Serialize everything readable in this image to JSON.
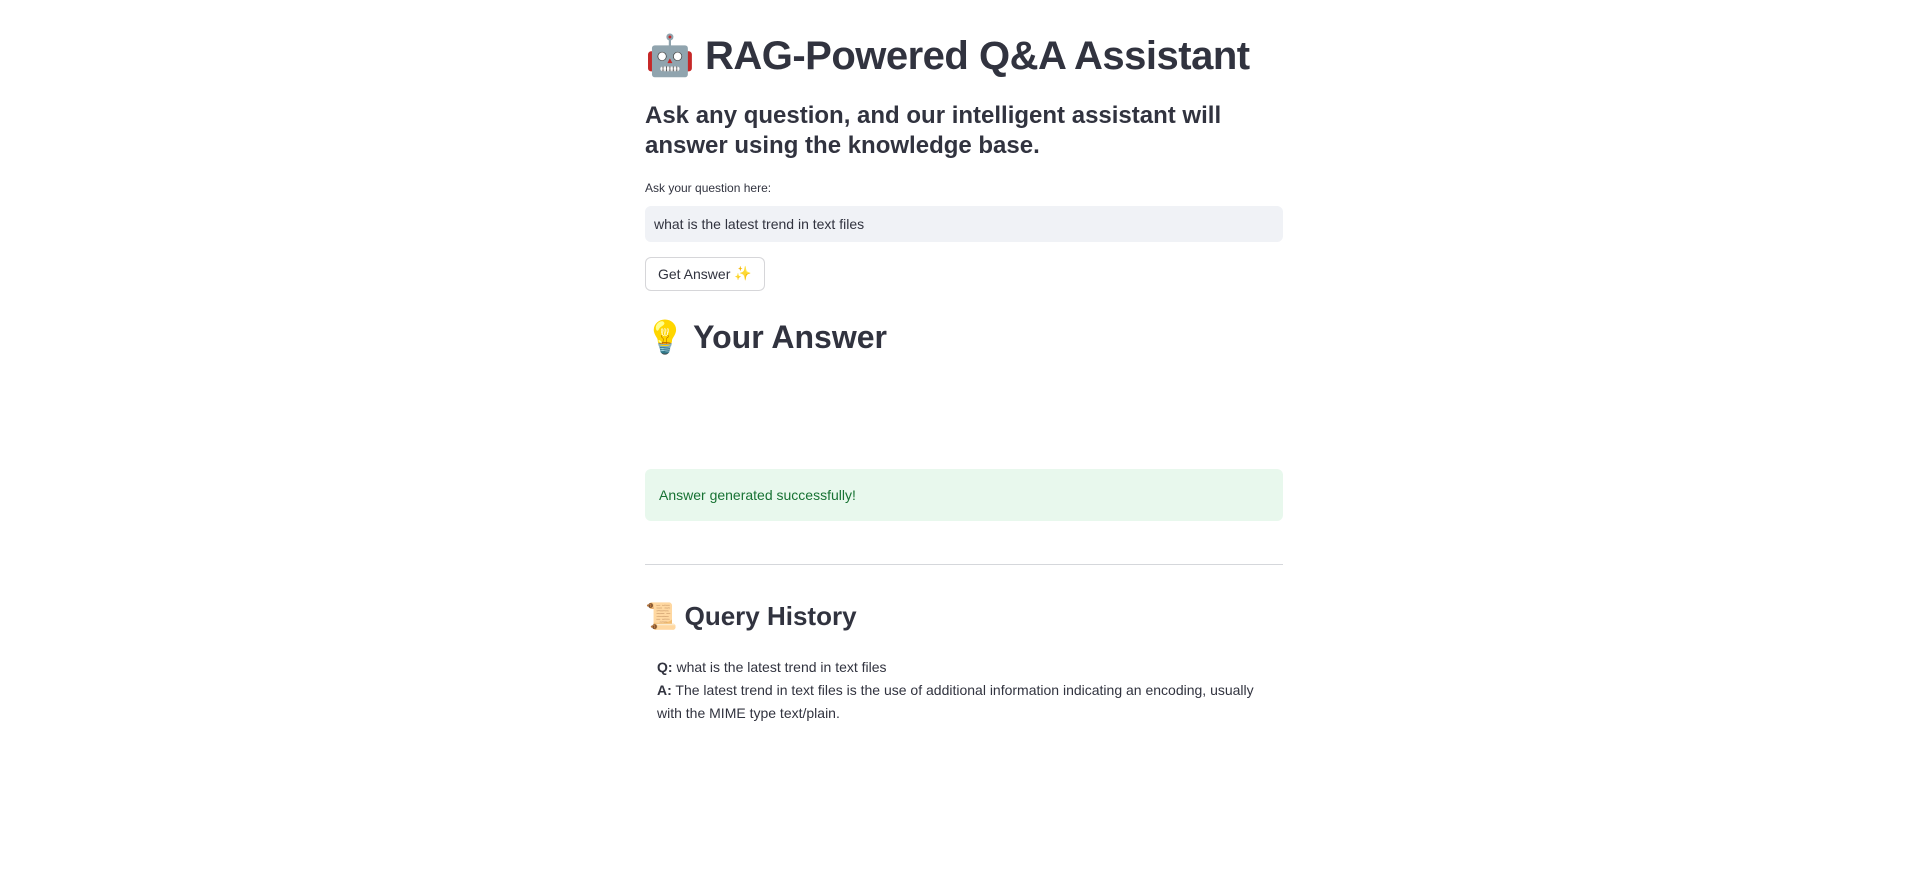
{
  "header": {
    "title_icon": "🤖",
    "title": "RAG-Powered Q&A Assistant",
    "subtitle": "Ask any question, and our intelligent assistant will answer using the knowledge base."
  },
  "query": {
    "label": "Ask your question here:",
    "value": "what is the latest trend in text files"
  },
  "action": {
    "button_label": "Get Answer",
    "button_icon": "✨"
  },
  "answer": {
    "heading_icon": "💡",
    "heading": "Your Answer",
    "status_message": "Answer generated successfully!"
  },
  "history": {
    "heading_icon": "📜",
    "heading": "Query History",
    "items": [
      {
        "q_label": "Q:",
        "question": "what is the latest trend in text files",
        "a_label": "A:",
        "answer": "The latest trend in text files is the use of additional information indicating an encoding, usually with the MIME type text/plain."
      }
    ]
  },
  "colors": {
    "text": "#31333f",
    "success_bg": "#e8f8ed",
    "success_text": "#177233",
    "input_bg": "#f0f2f6"
  }
}
